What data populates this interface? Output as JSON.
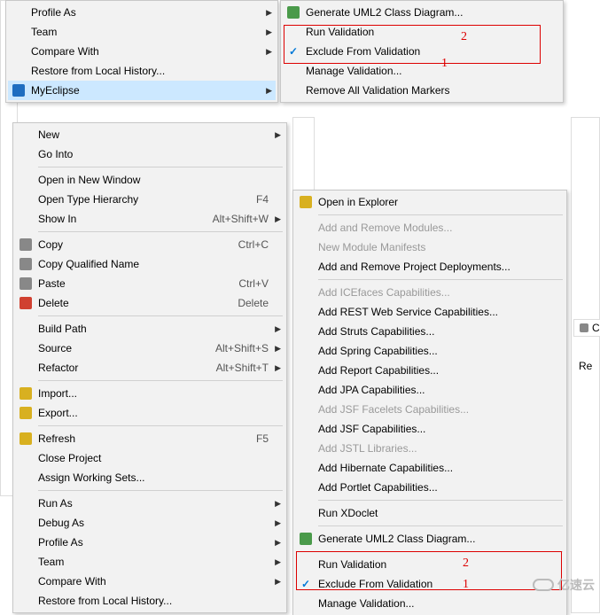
{
  "top_menu_a": {
    "items": [
      {
        "label": "Profile As",
        "arrow": true
      },
      {
        "label": "Team",
        "arrow": true
      },
      {
        "label": "Compare With",
        "arrow": true
      },
      {
        "label": "Restore from Local History..."
      },
      {
        "label": "MyEclipse",
        "arrow": true,
        "highlight": true,
        "icon": "blue"
      }
    ]
  },
  "top_menu_b": {
    "items": [
      {
        "label": "Generate UML2 Class Diagram...",
        "icon": "green"
      },
      {
        "label": "Run Validation"
      },
      {
        "label": "Exclude From Validation",
        "check": true
      },
      {
        "label": "Manage Validation..."
      },
      {
        "label": "Remove All Validation Markers"
      }
    ],
    "anno1": "2",
    "anno2": "1"
  },
  "bottom_menu_a": {
    "items": [
      {
        "label": "New",
        "arrow": true
      },
      {
        "label": "Go Into"
      },
      {
        "sep": true
      },
      {
        "label": "Open in New Window"
      },
      {
        "label": "Open Type Hierarchy",
        "shortcut": "F4"
      },
      {
        "label": "Show In",
        "shortcut": "Alt+Shift+W",
        "arrow": true
      },
      {
        "sep": true
      },
      {
        "label": "Copy",
        "shortcut": "Ctrl+C",
        "icon": "gray"
      },
      {
        "label": "Copy Qualified Name",
        "icon": "gray"
      },
      {
        "label": "Paste",
        "shortcut": "Ctrl+V",
        "icon": "gray"
      },
      {
        "label": "Delete",
        "shortcut": "Delete",
        "icon": "red"
      },
      {
        "sep": true
      },
      {
        "label": "Build Path",
        "arrow": true
      },
      {
        "label": "Source",
        "shortcut": "Alt+Shift+S",
        "arrow": true
      },
      {
        "label": "Refactor",
        "shortcut": "Alt+Shift+T",
        "arrow": true
      },
      {
        "sep": true
      },
      {
        "label": "Import...",
        "icon": "yellow"
      },
      {
        "label": "Export...",
        "icon": "yellow"
      },
      {
        "sep": true
      },
      {
        "label": "Refresh",
        "shortcut": "F5",
        "icon": "yellow"
      },
      {
        "label": "Close Project"
      },
      {
        "label": "Assign Working Sets..."
      },
      {
        "sep": true
      },
      {
        "label": "Run As",
        "arrow": true
      },
      {
        "label": "Debug As",
        "arrow": true
      },
      {
        "label": "Profile As",
        "arrow": true
      },
      {
        "label": "Team",
        "arrow": true
      },
      {
        "label": "Compare With",
        "arrow": true
      },
      {
        "label": "Restore from Local History..."
      }
    ]
  },
  "bottom_menu_b": {
    "items": [
      {
        "label": "Open in Explorer",
        "icon": "yellow"
      },
      {
        "sep": true
      },
      {
        "label": "Add and Remove Modules...",
        "disabled": true
      },
      {
        "label": "New Module Manifests",
        "disabled": true
      },
      {
        "label": "Add and Remove Project Deployments..."
      },
      {
        "sep": true
      },
      {
        "label": "Add ICEfaces Capabilities...",
        "disabled": true
      },
      {
        "label": "Add REST Web Service Capabilities..."
      },
      {
        "label": "Add Struts Capabilities..."
      },
      {
        "label": "Add Spring Capabilities..."
      },
      {
        "label": "Add Report Capabilities..."
      },
      {
        "label": "Add JPA Capabilities..."
      },
      {
        "label": "Add JSF Facelets Capabilities...",
        "disabled": true
      },
      {
        "label": "Add JSF Capabilities..."
      },
      {
        "label": "Add JSTL Libraries...",
        "disabled": true
      },
      {
        "label": "Add Hibernate Capabilities..."
      },
      {
        "label": "Add Portlet Capabilities..."
      },
      {
        "sep": true
      },
      {
        "label": "Run XDoclet"
      },
      {
        "sep": true
      },
      {
        "label": "Generate UML2 Class Diagram...",
        "icon": "green"
      },
      {
        "sep": true
      },
      {
        "label": "Run Validation"
      },
      {
        "label": "Exclude From Validation",
        "check": true
      },
      {
        "label": "Manage Validation..."
      }
    ],
    "anno1": "2",
    "anno2": "1"
  },
  "side_tab_co": "Co",
  "side_tab_re": "Re",
  "watermark": "亿速云"
}
